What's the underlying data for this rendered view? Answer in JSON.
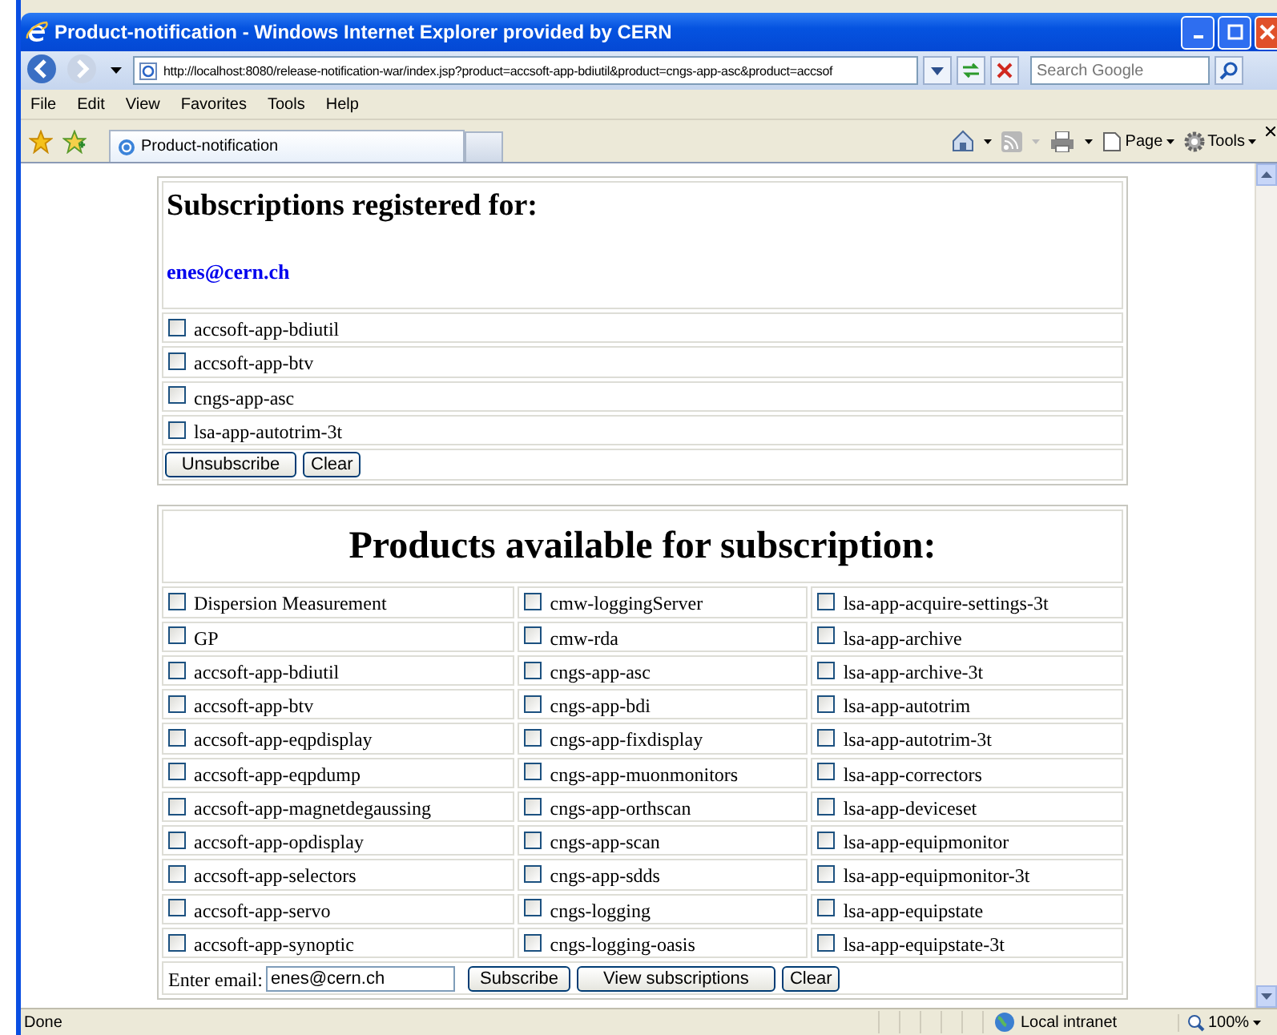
{
  "window": {
    "title": "Product-notification - Windows Internet Explorer provided by CERN"
  },
  "address_bar": {
    "url": "http://localhost:8080/release-notification-war/index.jsp?product=accsoft-app-bdiutil&product=cngs-app-asc&product=accsof"
  },
  "search": {
    "placeholder": "Search Google"
  },
  "menu": [
    "File",
    "Edit",
    "View",
    "Favorites",
    "Tools",
    "Help"
  ],
  "tabs": [
    {
      "label": "Product-notification",
      "selected": true
    }
  ],
  "command_bar": [
    "Page",
    "Tools"
  ],
  "subscriptions": {
    "heading": "Subscriptions registered for:",
    "email": "enes@cern.ch",
    "items": [
      {
        "label": "accsoft-app-bdiutil",
        "checked": false
      },
      {
        "label": "accsoft-app-btv",
        "checked": false
      },
      {
        "label": "cngs-app-asc",
        "checked": false
      },
      {
        "label": "lsa-app-autotrim-3t",
        "checked": false
      }
    ],
    "buttons": [
      "Unsubscribe",
      "Clear"
    ]
  },
  "products": {
    "heading": "Products available for subscription:",
    "rows": [
      [
        {
          "label": "Dispersion Measurement",
          "checked": false
        },
        {
          "label": "cmw-loggingServer",
          "checked": false
        },
        {
          "label": "lsa-app-acquire-settings-3t",
          "checked": false
        }
      ],
      [
        {
          "label": "GP",
          "checked": false
        },
        {
          "label": "cmw-rda",
          "checked": false
        },
        {
          "label": "lsa-app-archive",
          "checked": false
        }
      ],
      [
        {
          "label": "accsoft-app-bdiutil",
          "checked": false
        },
        {
          "label": "cngs-app-asc",
          "checked": false
        },
        {
          "label": "lsa-app-archive-3t",
          "checked": false
        }
      ],
      [
        {
          "label": "accsoft-app-btv",
          "checked": false
        },
        {
          "label": "cngs-app-bdi",
          "checked": false
        },
        {
          "label": "lsa-app-autotrim",
          "checked": false
        }
      ],
      [
        {
          "label": "accsoft-app-eqpdisplay",
          "checked": false
        },
        {
          "label": "cngs-app-fixdisplay",
          "checked": false
        },
        {
          "label": "lsa-app-autotrim-3t",
          "checked": false
        }
      ],
      [
        {
          "label": "accsoft-app-eqpdump",
          "checked": false
        },
        {
          "label": "cngs-app-muonmonitors",
          "checked": false
        },
        {
          "label": "lsa-app-correctors",
          "checked": false
        }
      ],
      [
        {
          "label": "accsoft-app-magnetdegaussing",
          "checked": false
        },
        {
          "label": "cngs-app-orthscan",
          "checked": false
        },
        {
          "label": "lsa-app-deviceset",
          "checked": false
        }
      ],
      [
        {
          "label": "accsoft-app-opdisplay",
          "checked": false
        },
        {
          "label": "cngs-app-scan",
          "checked": false
        },
        {
          "label": "lsa-app-equipmonitor",
          "checked": false
        }
      ],
      [
        {
          "label": "accsoft-app-selectors",
          "checked": false
        },
        {
          "label": "cngs-app-sdds",
          "checked": false
        },
        {
          "label": "lsa-app-equipmonitor-3t",
          "checked": false
        }
      ],
      [
        {
          "label": "accsoft-app-servo",
          "checked": false
        },
        {
          "label": "cngs-logging",
          "checked": false
        },
        {
          "label": "lsa-app-equipstate",
          "checked": false
        }
      ],
      [
        {
          "label": "accsoft-app-synoptic",
          "checked": false
        },
        {
          "label": "cngs-logging-oasis",
          "checked": false
        },
        {
          "label": "lsa-app-equipstate-3t",
          "checked": false
        }
      ]
    ],
    "email_label": "Enter email:",
    "email_value": "enes@cern.ch",
    "buttons": [
      "Subscribe",
      "View subscriptions",
      "Clear"
    ]
  },
  "status_bar": {
    "text": "Done",
    "zone": "Local intranet",
    "zoom": "100%"
  }
}
